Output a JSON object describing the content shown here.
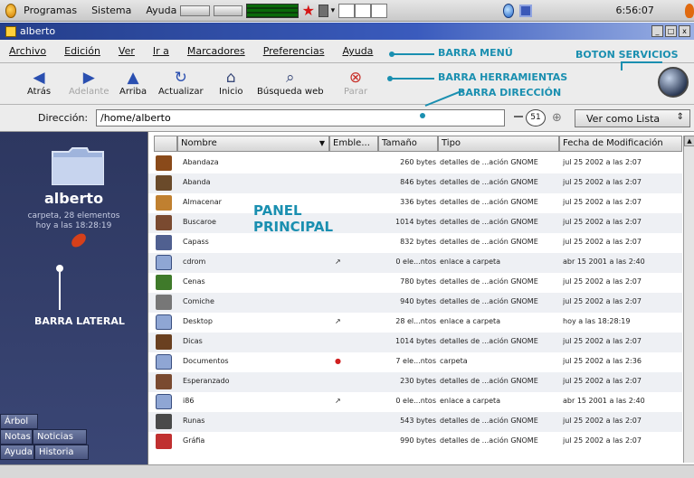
{
  "top_panel": {
    "menus": [
      "Programas",
      "Sistema",
      "Ayuda"
    ],
    "clock": "6:56:07"
  },
  "window": {
    "title": "alberto",
    "buttons": [
      "_",
      "□",
      "x"
    ]
  },
  "menubar": {
    "items": [
      "Archivo",
      "Edición",
      "Ver",
      "Ir a",
      "Marcadores",
      "Preferencias",
      "Ayuda"
    ]
  },
  "toolbar": {
    "buttons": [
      {
        "label": "Atrás",
        "icon": "back-arrow-icon",
        "enabled": true
      },
      {
        "label": "Adelante",
        "icon": "forward-arrow-icon",
        "enabled": false
      },
      {
        "label": "Arriba",
        "icon": "up-arrow-icon",
        "enabled": true
      },
      {
        "label": "Actualizar",
        "icon": "refresh-icon",
        "enabled": true
      },
      {
        "label": "Inicio",
        "icon": "home-icon",
        "enabled": true
      },
      {
        "label": "Búsqueda web",
        "icon": "web-search-icon",
        "enabled": true
      },
      {
        "label": "Parar",
        "icon": "stop-icon",
        "enabled": false
      }
    ]
  },
  "addressbar": {
    "label": "Dirección:",
    "value": "/home/alberto",
    "zoom": "51",
    "view_mode": "Ver como Lista"
  },
  "sidebar": {
    "title": "alberto",
    "info_line1": "carpeta, 28 elementos",
    "info_line2": "hoy a las 18:28:19",
    "tabs": [
      "Árbol",
      "Notas",
      "Noticias",
      "Ayuda",
      "Historia"
    ]
  },
  "table": {
    "columns": [
      "Nombre",
      "Emble...",
      "Tamaño",
      "Tipo",
      "Fecha de Modificación"
    ],
    "rows": [
      {
        "name": "Abandaza",
        "emblem": "",
        "size": "260 bytes",
        "type": "detalles de ...ación GNOME",
        "date": "jul 25 2002 a las 2:07",
        "icon": "people-icon"
      },
      {
        "name": "Abanda",
        "emblem": "",
        "size": "846 bytes",
        "type": "detalles de ...ación GNOME",
        "date": "jul 25 2002 a las 2:07",
        "icon": "picture-icon"
      },
      {
        "name": "Almacenar",
        "emblem": "",
        "size": "336 bytes",
        "type": "detalles de ...ación GNOME",
        "date": "jul 25 2002 a las 2:07",
        "icon": "tool-icon"
      },
      {
        "name": "Buscaroe",
        "emblem": "",
        "size": "1014 bytes",
        "type": "detalles de ...ación GNOME",
        "date": "jul 25 2002 a las 2:07",
        "icon": "person-icon"
      },
      {
        "name": "Capass",
        "emblem": "",
        "size": "832 bytes",
        "type": "detalles de ...ación GNOME",
        "date": "jul 25 2002 a las 2:07",
        "icon": "screen-icon"
      },
      {
        "name": "cdrom",
        "emblem": "↗",
        "size": "0 ele...ntos",
        "type": "enlace a carpeta",
        "date": "abr 15 2001 a las 2:40",
        "icon": "folder-icon"
      },
      {
        "name": "Cenas",
        "emblem": "",
        "size": "780 bytes",
        "type": "detalles de ...ación GNOME",
        "date": "jul 25 2002 a las 2:07",
        "icon": "chart-icon"
      },
      {
        "name": "Comiche",
        "emblem": "",
        "size": "940 bytes",
        "type": "detalles de ...ación GNOME",
        "date": "jul 25 2002 a las 2:07",
        "icon": "gear-icon"
      },
      {
        "name": "Desktop",
        "emblem": "↗",
        "size": "28 el...ntos",
        "type": "enlace a carpeta",
        "date": "hoy a las 18:28:19",
        "icon": "folder-icon"
      },
      {
        "name": "Dicas",
        "emblem": "",
        "size": "1014 bytes",
        "type": "detalles de ...ación GNOME",
        "date": "jul 25 2002 a las 2:07",
        "icon": "building-icon"
      },
      {
        "name": "Documentos",
        "emblem": "●",
        "size": "7 ele...ntos",
        "type": "carpeta",
        "date": "jul 25 2002 a las 2:36",
        "icon": "folder-icon"
      },
      {
        "name": "Esperanzado",
        "emblem": "",
        "size": "230 bytes",
        "type": "detalles de ...ación GNOME",
        "date": "jul 25 2002 a las 2:07",
        "icon": "person-icon"
      },
      {
        "name": "i86",
        "emblem": "↗",
        "size": "0 ele...ntos",
        "type": "enlace a carpeta",
        "date": "abr 15 2001 a las 2:40",
        "icon": "folder-icon"
      },
      {
        "name": "Runas",
        "emblem": "",
        "size": "543 bytes",
        "type": "detalles de ...ación GNOME",
        "date": "jul 25 2002 a las 2:07",
        "icon": "globe-icon"
      },
      {
        "name": "Gráfia",
        "emblem": "",
        "size": "990 bytes",
        "type": "detalles de ...ación GNOME",
        "date": "jul 25 2002 a las 2:07",
        "icon": "flag-icon"
      }
    ]
  },
  "annotations": {
    "menu": "BARRA MENÚ",
    "services": "BOTON SERVICIOS",
    "tools": "BARRA HERRAMIENTAS",
    "address": "BARRA DIRECCIÓN",
    "main_line1": "PANEL",
    "main_line2": "PRINCIPAL",
    "sidebar": "BARRA LATERAL"
  },
  "colors": {
    "annotation": "#1a8fb0",
    "sidebar_bg": "#2d3760",
    "title_bar": "#243e8a"
  }
}
